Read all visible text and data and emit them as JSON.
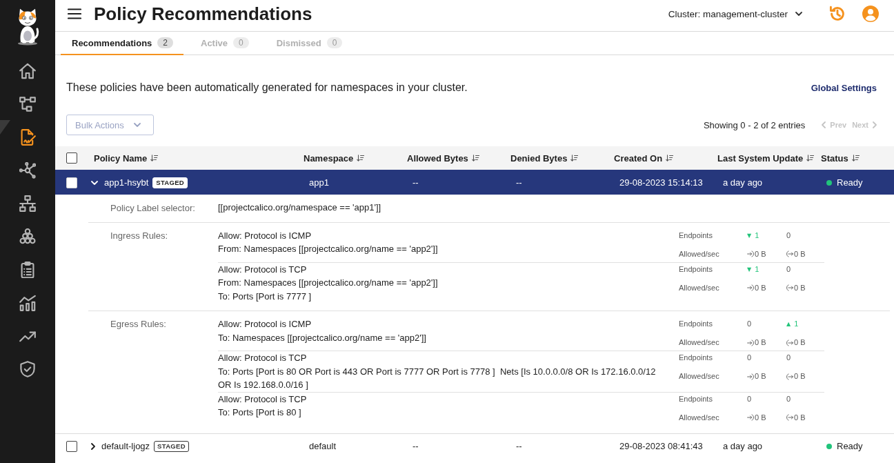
{
  "sidebar": {
    "items": [
      {
        "selected": false
      },
      {
        "selected": false
      },
      {
        "selected": true
      },
      {
        "selected": false
      },
      {
        "selected": false
      },
      {
        "selected": false
      },
      {
        "selected": false
      },
      {
        "selected": false
      },
      {
        "selected": false
      },
      {
        "selected": false
      }
    ]
  },
  "header": {
    "title": "Policy Recommendations",
    "cluster_selector": {
      "label": "Cluster: management-cluster"
    }
  },
  "tabs": [
    {
      "label": "Recommendations",
      "count": "2",
      "selected": true
    },
    {
      "label": "Active",
      "count": "0",
      "selected": false
    },
    {
      "label": "Dismissed",
      "count": "0",
      "selected": false
    }
  ],
  "description": "These policies have been automatically generated for namespaces in your cluster.",
  "global_settings_link": "Global Settings",
  "bulk_actions": {
    "label": "Bulk Actions",
    "disabled": true
  },
  "pagination": {
    "summary": "Showing 0 - 2 of 2 entries",
    "prev": {
      "label": "Prev",
      "disabled": true
    },
    "next": {
      "label": "Next",
      "disabled": true
    }
  },
  "table": {
    "select_all": {
      "checked": false
    },
    "columns": [
      "Policy Name",
      "Namespace",
      "Allowed Bytes",
      "Denied Bytes",
      "Created On",
      "Last System Update",
      "Status"
    ],
    "rows": [
      {
        "checked": false,
        "selected": true,
        "expanded": true,
        "name": "app1-hsybt",
        "tag": "STAGED",
        "namespace": "app1",
        "allowed_bytes": "--",
        "denied_bytes": "--",
        "created_on": "29-08-2023 15:14:13",
        "last_update": "a day ago",
        "status": {
          "label": "Ready",
          "color": "#21c47b"
        },
        "details": {
          "selector": {
            "label": "Policy Label selector:",
            "value": "[[projectcalico.org/namespace == 'app1']]"
          },
          "sections": [
            {
              "label": "Ingress Rules:",
              "rules": [
                {
                  "lines": [
                    "Allow: Protocol is ICMP",
                    "From: Namespaces [[projectcalico.org/name == 'app2']]"
                  ],
                  "stats": [
                    {
                      "kind": "endpoints",
                      "label": "Endpoints",
                      "values": [
                        {
                          "marker": "▼",
                          "value": "1"
                        },
                        {
                          "value": "0"
                        }
                      ]
                    },
                    {
                      "kind": "traffic",
                      "label": "Allowed/sec",
                      "values": [
                        {
                          "value": "0 B"
                        },
                        {
                          "value": "0 B"
                        }
                      ]
                    }
                  ]
                },
                {
                  "lines": [
                    "Allow: Protocol is TCP",
                    "From: Namespaces [[projectcalico.org/name == 'app2']]",
                    "To: Ports [Port is 7777 ]"
                  ],
                  "stats": [
                    {
                      "kind": "endpoints",
                      "label": "Endpoints",
                      "values": [
                        {
                          "marker": "▼",
                          "value": "1"
                        },
                        {
                          "value": "0"
                        }
                      ]
                    },
                    {
                      "kind": "traffic",
                      "label": "Allowed/sec",
                      "values": [
                        {
                          "value": "0 B"
                        },
                        {
                          "value": "0 B"
                        }
                      ]
                    }
                  ]
                }
              ]
            },
            {
              "label": "Egress Rules:",
              "rules": [
                {
                  "lines": [
                    "Allow: Protocol is ICMP",
                    "To: Namespaces [[projectcalico.org/name == 'app2']]"
                  ],
                  "stats": [
                    {
                      "kind": "endpoints",
                      "label": "Endpoints",
                      "values": [
                        {
                          "value": "0"
                        },
                        {
                          "marker": "▲",
                          "value": "1"
                        }
                      ]
                    },
                    {
                      "kind": "traffic",
                      "label": "Allowed/sec",
                      "values": [
                        {
                          "value": "0 B"
                        },
                        {
                          "value": "0 B"
                        }
                      ]
                    }
                  ]
                },
                {
                  "lines": [
                    "Allow: Protocol is TCP",
                    "To: Ports [Port is 80 OR Port is 443 OR Port is 7777 OR Port is 7778 ]  Nets [Is 10.0.0.0/8 OR Is 172.16.0.0/12 OR Is 192.168.0.0/16 ]"
                  ],
                  "stats": [
                    {
                      "kind": "endpoints",
                      "label": "Endpoints",
                      "values": [
                        {
                          "value": "0"
                        },
                        {
                          "value": "0"
                        }
                      ]
                    },
                    {
                      "kind": "traffic",
                      "label": "Allowed/sec",
                      "values": [
                        {
                          "value": "0 B"
                        },
                        {
                          "value": "0 B"
                        }
                      ]
                    }
                  ]
                },
                {
                  "lines": [
                    "Allow: Protocol is TCP",
                    "To: Ports [Port is 80 ]"
                  ],
                  "stats": [
                    {
                      "kind": "endpoints",
                      "label": "Endpoints",
                      "values": [
                        {
                          "value": "0"
                        },
                        {
                          "value": "0"
                        }
                      ]
                    },
                    {
                      "kind": "traffic",
                      "label": "Allowed/sec",
                      "values": [
                        {
                          "value": "0 B"
                        },
                        {
                          "value": "0 B"
                        }
                      ]
                    }
                  ]
                }
              ]
            }
          ]
        }
      },
      {
        "checked": false,
        "selected": false,
        "expanded": false,
        "name": "default-ljogz",
        "tag": "STAGED",
        "namespace": "default",
        "allowed_bytes": "--",
        "denied_bytes": "--",
        "created_on": "29-08-2023 08:41:43",
        "last_update": "a day ago",
        "status": {
          "label": "Ready",
          "color": "#21c47b"
        }
      }
    ]
  }
}
